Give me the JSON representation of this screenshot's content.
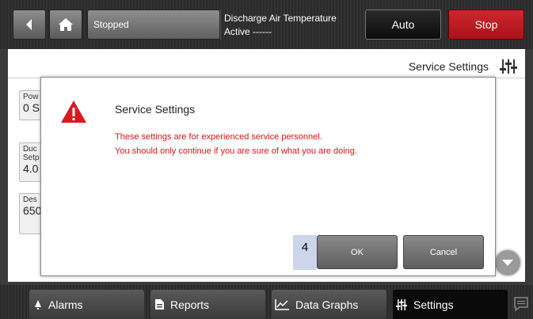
{
  "header": {
    "back_icon": "chevron-left-icon",
    "home_icon": "home-icon",
    "status": "Stopped",
    "info_title": "Discharge Air Temperature",
    "info_status": "Active ------",
    "auto_label": "Auto",
    "stop_label": "Stop",
    "stop_color": "#c41e25"
  },
  "page": {
    "title": "Service Settings",
    "icon": "sliders-icon"
  },
  "cards": [
    {
      "label": "Pow",
      "value": "0 S"
    },
    {
      "label": "Duc Setp",
      "value": "4.0"
    },
    {
      "label": "Des",
      "value": "650"
    }
  ],
  "dialog": {
    "title": "Service Settings",
    "warning_icon": "warning-icon",
    "message_line1": "These settings are for experienced service personnel.",
    "message_line2": "You should only continue if you are sure of what you are doing.",
    "badge": "4",
    "ok_label": "OK",
    "cancel_label": "Cancel",
    "message_color": "#d01616"
  },
  "nav": {
    "tabs": [
      {
        "label": "Alarms",
        "icon": "bell-icon"
      },
      {
        "label": "Reports",
        "icon": "document-icon"
      },
      {
        "label": "Data Graphs",
        "icon": "chart-icon"
      },
      {
        "label": "Settings",
        "icon": "sliders-icon",
        "active": true
      }
    ],
    "chat_icon": "chat-icon"
  }
}
